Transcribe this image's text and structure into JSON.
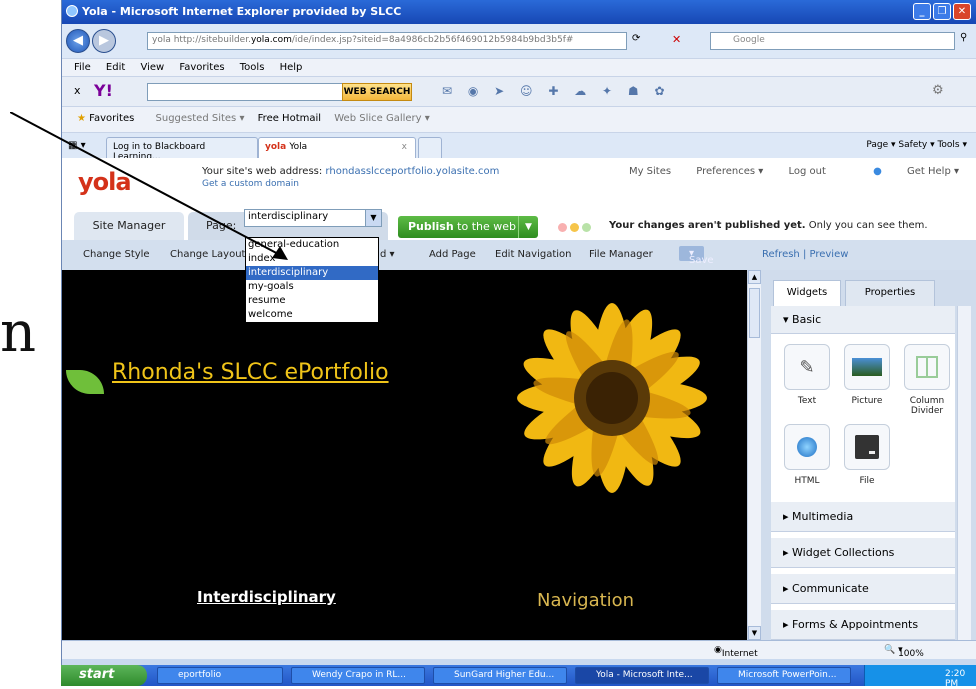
{
  "slide": {
    "partial_letter": "n"
  },
  "window": {
    "title": "Yola - Microsoft Internet Explorer provided by SLCC"
  },
  "address": {
    "url_prefix": "yola http://sitebuilder.",
    "url_domain": "yola.com",
    "url_rest": "/ide/index.jsp?siteid=8a4986cb2b56f469012b5984b9bd3b5f#",
    "search_placeholder": "Google"
  },
  "menu": [
    "File",
    "Edit",
    "View",
    "Favorites",
    "Tools",
    "Help"
  ],
  "yahoo": {
    "web_search": "WEB SEARCH"
  },
  "favorites": {
    "label": "Favorites",
    "items": [
      "Suggested Sites ▾",
      "Free Hotmail",
      "Web Slice Gallery ▾"
    ]
  },
  "tabs": {
    "items": [
      "Log in to Blackboard Learning...",
      "Yola"
    ],
    "commands": "Page ▾   Safety ▾   Tools ▾"
  },
  "yola": {
    "logo": "yola",
    "address_text": "Your site's web address: ",
    "address_link": "rhondasslcceportfolio.yolasite.com",
    "custom_domain": "Get a custom domain",
    "top_links": [
      "My Sites",
      "Preferences ▾",
      "Log out",
      "Get Help ▾"
    ],
    "site_manager": "Site Manager",
    "page_label": "Page:",
    "page_value": "interdisciplinary",
    "publish_bold": "Publish",
    "publish_rest": " to the web",
    "unpublished_bold": "Your changes aren't published yet.",
    "unpublished_rest": " Only you can see them.",
    "edit_items": [
      "Change Style",
      "Change Layout",
      "d ▾",
      "Add Page",
      "Edit Navigation",
      "File Manager"
    ],
    "save": "Save",
    "refresh_preview": "Refresh | Preview",
    "dropdown": [
      "general-education",
      "index",
      "interdisciplinary",
      "my-goals",
      "resume",
      "welcome"
    ],
    "site_title": "Rhonda's SLCC ePortfolio",
    "heading_interdisciplinary": "Interdisciplinary",
    "navigation": "Navigation"
  },
  "panel": {
    "tab_widgets": "Widgets",
    "tab_properties": "Properties",
    "basic": "Basic",
    "widgets": [
      "Text",
      "Picture",
      "Column Divider",
      "HTML",
      "File"
    ],
    "sections": [
      "Multimedia",
      "Widget Collections",
      "Communicate",
      "Forms & Appointments"
    ]
  },
  "status": {
    "zone": "Internet",
    "zoom": "100%"
  },
  "taskbar": {
    "start": "start",
    "items": [
      "eportfolio",
      "Wendy Crapo in RL...",
      "SunGard Higher Edu...",
      "Yola - Microsoft Inte...",
      "Microsoft PowerPoin..."
    ],
    "time": "2:20 PM"
  }
}
